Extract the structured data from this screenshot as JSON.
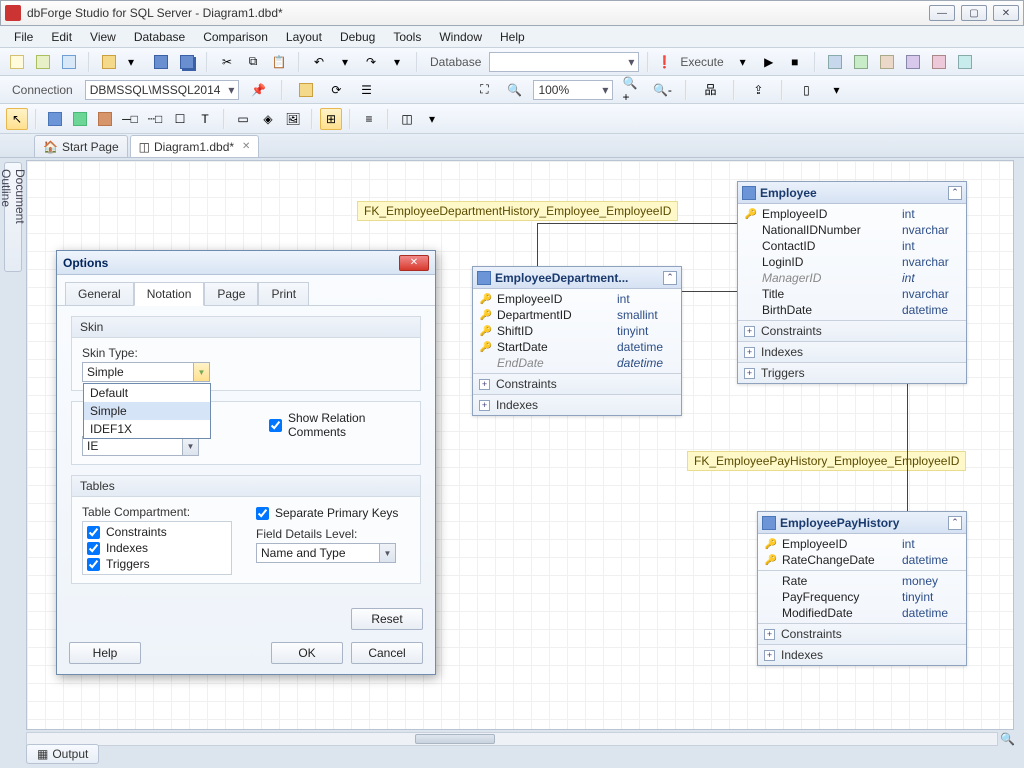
{
  "window": {
    "title": "dbForge Studio for SQL Server - Diagram1.dbd*"
  },
  "menu": [
    "File",
    "Edit",
    "View",
    "Database",
    "Comparison",
    "Layout",
    "Debug",
    "Tools",
    "Window",
    "Help"
  ],
  "toolbar1": {
    "database_label": "Database",
    "execute_label": "Execute"
  },
  "connection": {
    "label": "Connection",
    "value": "DBMSSQL\\MSSQL2014"
  },
  "zoom": {
    "value": "100%"
  },
  "tabs": [
    {
      "label": "Start Page",
      "closable": false
    },
    {
      "label": "Diagram1.dbd*",
      "closable": true,
      "active": true
    }
  ],
  "side_panel": "Document Outline",
  "rel_labels": {
    "top": "FK_EmployeeDepartmentHistory_Employee_EmployeeID",
    "bottom": "FK_EmployeePayHistory_Employee_EmployeeID"
  },
  "entities": {
    "edh": {
      "name": "EmployeeDepartment...",
      "cols": [
        {
          "k": true,
          "n": "EmployeeID",
          "t": "int"
        },
        {
          "k": true,
          "n": "DepartmentID",
          "t": "smallint"
        },
        {
          "k": true,
          "n": "ShiftID",
          "t": "tinyint"
        },
        {
          "k": true,
          "n": "StartDate",
          "t": "datetime"
        },
        {
          "k": false,
          "n": "EndDate",
          "t": "datetime",
          "faded": true
        }
      ],
      "sections": [
        "Constraints",
        "Indexes"
      ]
    },
    "emp": {
      "name": "Employee",
      "cols": [
        {
          "k": true,
          "n": "EmployeeID",
          "t": "int"
        },
        {
          "k": false,
          "n": "NationalIDNumber",
          "t": "nvarchar"
        },
        {
          "k": false,
          "n": "ContactID",
          "t": "int"
        },
        {
          "k": false,
          "n": "LoginID",
          "t": "nvarchar"
        },
        {
          "k": false,
          "n": "ManagerID",
          "t": "int",
          "faded": true
        },
        {
          "k": false,
          "n": "Title",
          "t": "nvarchar"
        },
        {
          "k": false,
          "n": "BirthDate",
          "t": "datetime"
        }
      ],
      "sections": [
        "Constraints",
        "Indexes",
        "Triggers"
      ]
    },
    "eph": {
      "name": "EmployeePayHistory",
      "cols": [
        {
          "k": true,
          "n": "EmployeeID",
          "t": "int"
        },
        {
          "k": true,
          "n": "RateChangeDate",
          "t": "datetime"
        },
        {
          "k": false,
          "n": "Rate",
          "t": "money"
        },
        {
          "k": false,
          "n": "PayFrequency",
          "t": "tinyint"
        },
        {
          "k": false,
          "n": "ModifiedDate",
          "t": "datetime"
        }
      ],
      "sections": [
        "Constraints",
        "Indexes"
      ]
    }
  },
  "dialog": {
    "title": "Options",
    "tabs": [
      "General",
      "Notation",
      "Page",
      "Print"
    ],
    "active_tab": "Notation",
    "skin": {
      "group": "Skin",
      "label": "Skin Type:",
      "value": "Simple",
      "options": [
        "Default",
        "Simple",
        "IDEF1X"
      ]
    },
    "relation": {
      "show_comments": "Show Relation Comments",
      "notation_value": "IE"
    },
    "tables": {
      "group": "Tables",
      "compartment_label": "Table Compartment:",
      "compartments": [
        "Constraints",
        "Indexes",
        "Triggers"
      ],
      "separate_pk": "Separate Primary Keys",
      "field_details_label": "Field Details Level:",
      "field_details_value": "Name and Type"
    },
    "buttons": {
      "reset": "Reset",
      "help": "Help",
      "ok": "OK",
      "cancel": "Cancel"
    }
  },
  "output_tab": "Output"
}
